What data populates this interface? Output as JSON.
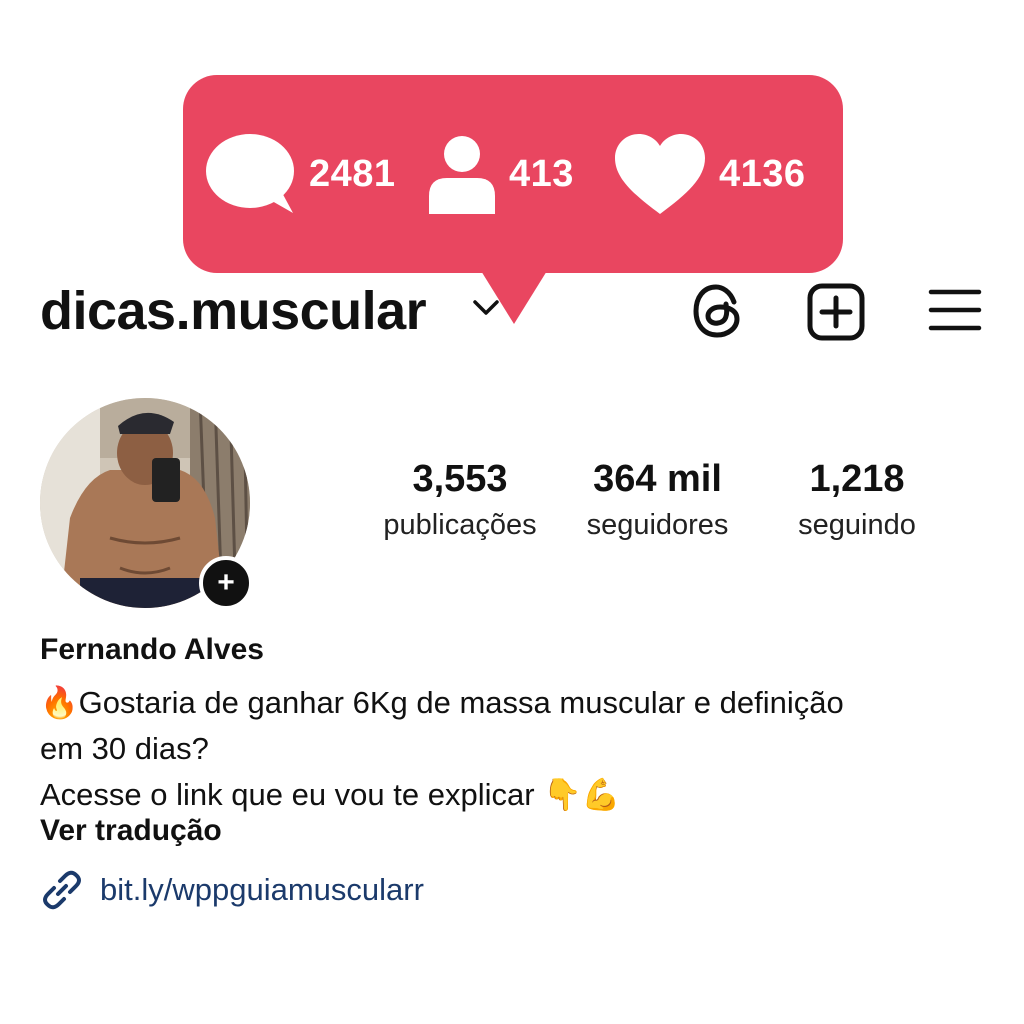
{
  "notification": {
    "comments": "2481",
    "followers": "413",
    "likes": "4136",
    "color": "#e94660"
  },
  "header": {
    "username": "dicas.muscular",
    "icons": [
      "chevron-down-icon",
      "threads-icon",
      "new-post-icon",
      "menu-icon"
    ]
  },
  "stats": [
    {
      "value": "3,553",
      "label": "publicações"
    },
    {
      "value": "364 mil",
      "label": "seguidores"
    },
    {
      "value": "1,218",
      "label": "seguindo"
    }
  ],
  "profile": {
    "full_name": "Fernando Alves",
    "bio_line1": "Gostaria de ganhar 6Kg de massa muscular e definição",
    "bio_line2": "em 30 dias?",
    "bio_line3": "Acesse o link que eu vou te explicar",
    "translate": "Ver tradução",
    "link": "bit.ly/wppguiamuscularr"
  }
}
